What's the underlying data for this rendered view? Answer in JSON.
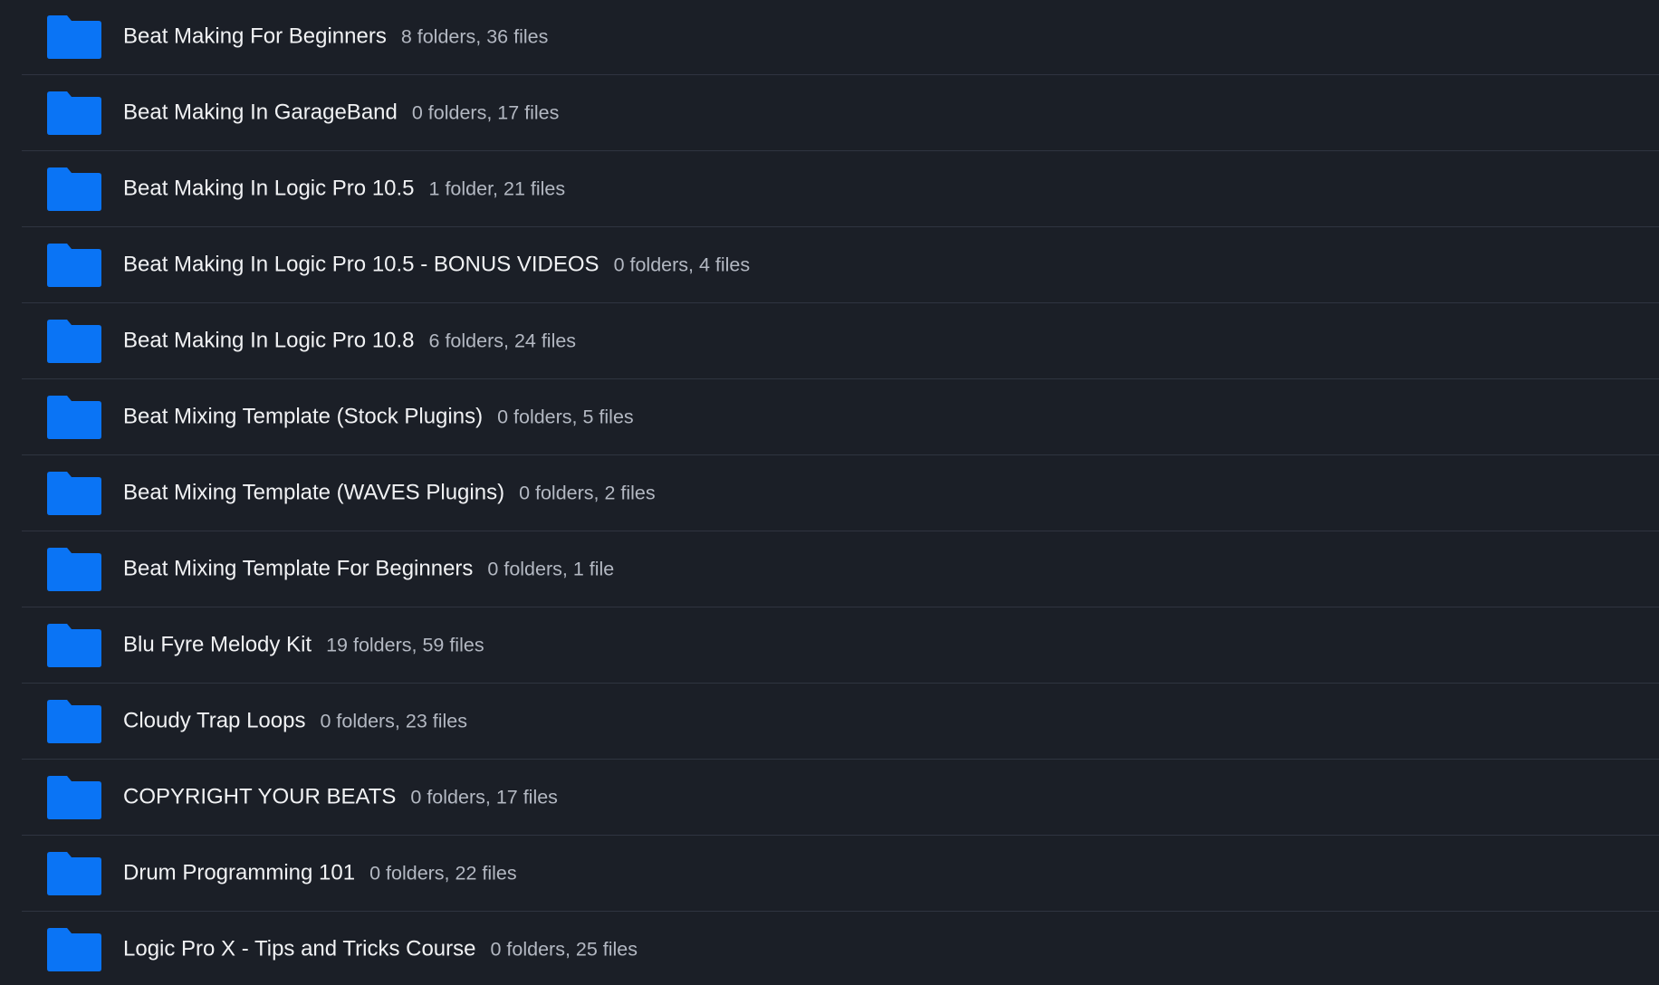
{
  "folder_color": "#0a74f5",
  "items": [
    {
      "name": "Beat Making For Beginners",
      "meta": "8 folders, 36 files"
    },
    {
      "name": "Beat Making In GarageBand",
      "meta": "0 folders, 17 files"
    },
    {
      "name": "Beat Making In Logic Pro 10.5",
      "meta": "1 folder, 21 files"
    },
    {
      "name": "Beat Making In Logic Pro 10.5 - BONUS VIDEOS",
      "meta": "0 folders, 4 files"
    },
    {
      "name": "Beat Making In Logic Pro 10.8",
      "meta": "6 folders, 24 files"
    },
    {
      "name": "Beat Mixing Template (Stock Plugins)",
      "meta": "0 folders, 5 files"
    },
    {
      "name": "Beat Mixing Template (WAVES Plugins)",
      "meta": "0 folders, 2 files"
    },
    {
      "name": "Beat Mixing Template For Beginners",
      "meta": "0 folders, 1 file"
    },
    {
      "name": "Blu Fyre Melody Kit",
      "meta": "19 folders, 59 files"
    },
    {
      "name": "Cloudy Trap Loops",
      "meta": "0 folders, 23 files"
    },
    {
      "name": "COPYRIGHT YOUR BEATS",
      "meta": "0 folders, 17 files"
    },
    {
      "name": "Drum Programming 101",
      "meta": "0 folders, 22 files"
    },
    {
      "name": "Logic Pro X - Tips and Tricks Course",
      "meta": "0 folders, 25 files"
    }
  ]
}
